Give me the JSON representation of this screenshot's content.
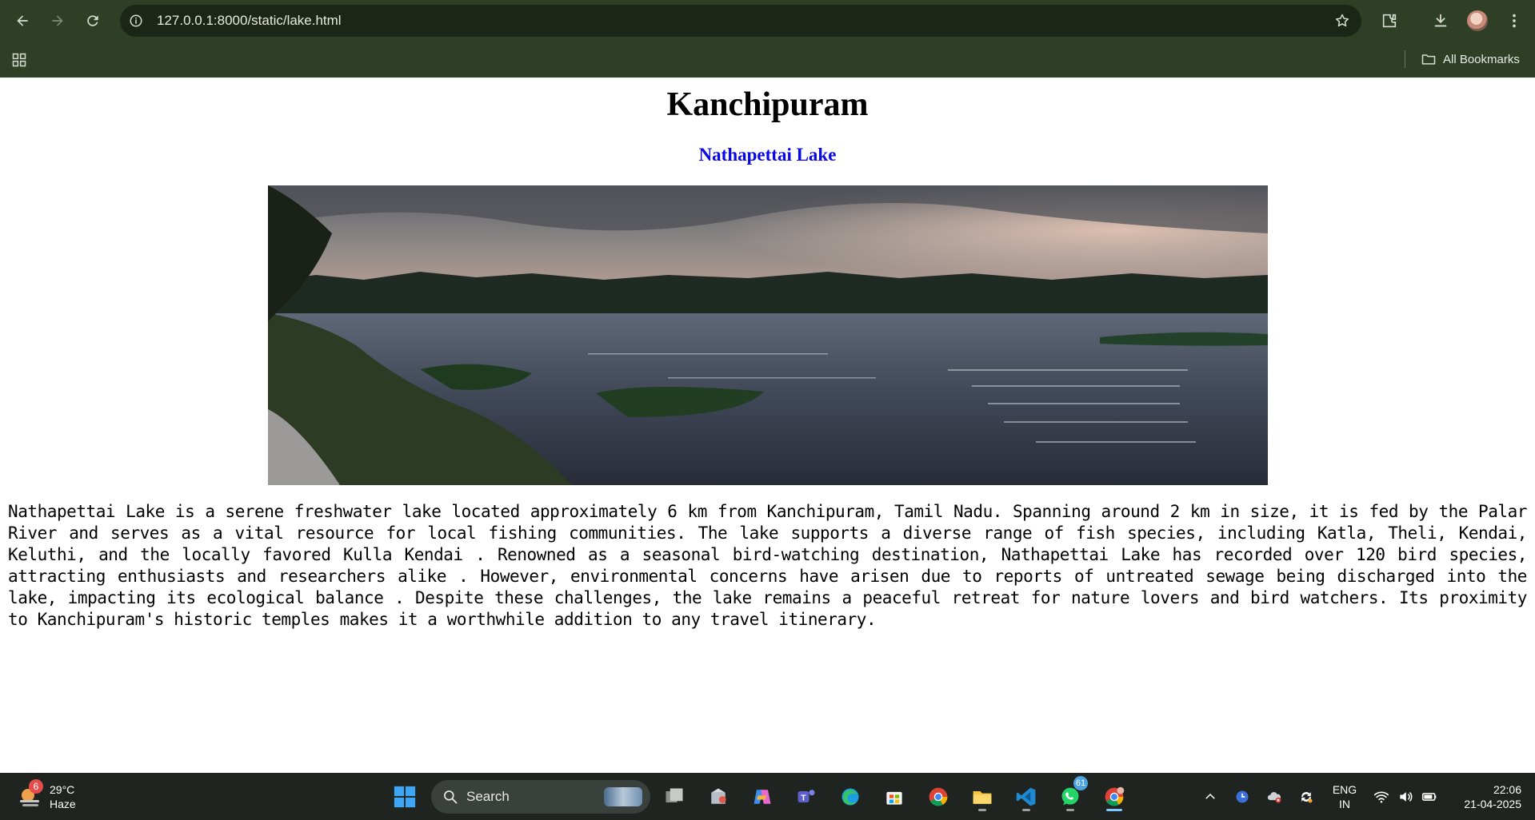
{
  "browser": {
    "url": "127.0.0.1:8000/static/lake.html",
    "bookmarks_label": "All Bookmarks",
    "icons": [
      "back-icon",
      "forward-icon",
      "reload-icon",
      "site-info-icon",
      "star-icon",
      "extensions-icon",
      "download-icon",
      "profile-avatar",
      "menu-icon",
      "apps-icon",
      "folder-icon"
    ]
  },
  "page": {
    "title": "Kanchipuram",
    "subtitle": "Nathapettai Lake",
    "image_alt": "Nathapettai Lake photo",
    "description": "Nathapettai Lake is a serene freshwater lake located approximately 6 km from Kanchipuram, Tamil Nadu. Spanning around 2 km in size, it is fed by the Palar River and serves as a vital resource for local fishing communities. The lake supports a diverse range of fish species, including Katla, Theli, Kendai, Keluthi, and the locally favored Kulla Kendai . Renowned as a seasonal bird-watching destination, Nathapettai Lake has recorded over 120 bird species, attracting enthusiasts and researchers alike . However, environmental concerns have arisen due to reports of untreated sewage being discharged into the lake, impacting its ecological balance . Despite these challenges, the lake remains a peaceful retreat for nature lovers and bird watchers. Its proximity to Kanchipuram's historic temples makes it a worthwhile addition to any travel itinerary.",
    "subtitle_color": "#0a08e6"
  },
  "taskbar": {
    "weather": {
      "temperature": "29°C",
      "condition": "Haze",
      "badge": "6"
    },
    "search_label": "Search",
    "whatsapp_badge": "61",
    "apps": [
      "start-icon",
      "task-view-icon",
      "store-package-icon",
      "copilot-icon",
      "teams-icon",
      "edge-icon",
      "microsoft-store-icon",
      "chrome-icon",
      "file-explorer-icon",
      "vscode-icon",
      "whatsapp-icon",
      "chrome-profile-icon"
    ],
    "language": {
      "line1": "ENG",
      "line2": "IN"
    },
    "clock": {
      "time": "22:06",
      "date": "21-04-2025"
    }
  }
}
